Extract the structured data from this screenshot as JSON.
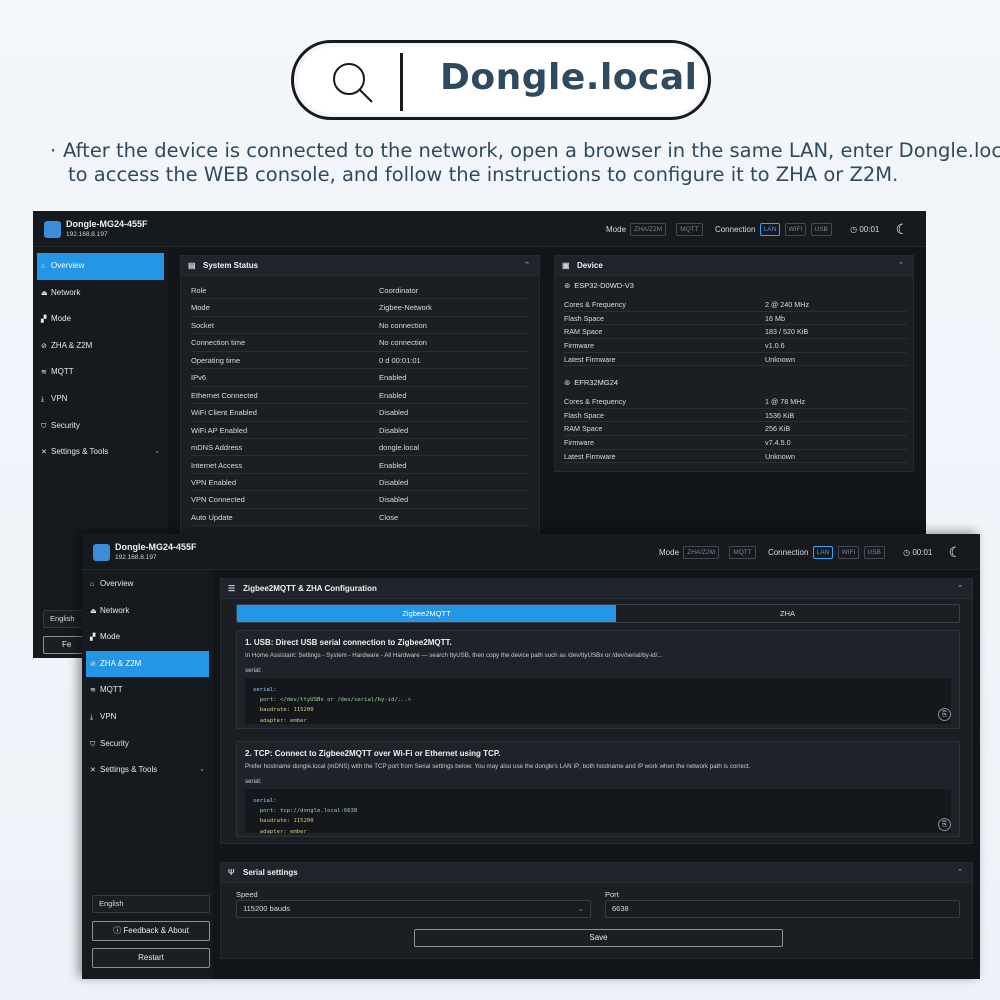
{
  "banner": {
    "url": "Dongle.local",
    "note_bullet": "·",
    "note_line1": "After the device is connected to the network, open a browser in the same LAN, enter Dongle.local",
    "note_line2": "to access the WEB console, and follow the instructions to configure it to ZHA or Z2M."
  },
  "header": {
    "device_name": "Dongle-MG24-455F",
    "ip": "192.168.8.197",
    "mode_label": "Mode",
    "mode_options": [
      "ZHA/Z2M",
      "MQTT"
    ],
    "connection_label": "Connection",
    "connection_options": [
      "LAN",
      "WIFI",
      "USB"
    ],
    "active_connection": "LAN",
    "uptime": "00:01"
  },
  "sidebar": {
    "items": [
      {
        "label": "Overview",
        "icon": "home-icon"
      },
      {
        "label": "Network",
        "icon": "network-icon"
      },
      {
        "label": "Mode",
        "icon": "chart-icon"
      },
      {
        "label": "ZHA & Z2M",
        "icon": "zigbee-icon"
      },
      {
        "label": "MQTT",
        "icon": "wifi-icon"
      },
      {
        "label": "VPN",
        "icon": "download-icon"
      },
      {
        "label": "Security",
        "icon": "shield-icon"
      },
      {
        "label": "Settings & Tools",
        "icon": "tools-icon"
      }
    ],
    "language": "English",
    "feedback_label": "Feedback & About",
    "feedback_partial": "Fe",
    "restart_label": "Restart"
  },
  "system_status": {
    "title": "System Status",
    "rows": [
      {
        "k": "Role",
        "v": "Coordinator"
      },
      {
        "k": "Mode",
        "v": "Zigbee-Network"
      },
      {
        "k": "Socket",
        "v": "No connection"
      },
      {
        "k": "Connection time",
        "v": "No connection"
      },
      {
        "k": "Operating time",
        "v": "0 d 00:01:01"
      },
      {
        "k": "IPv6",
        "v": "Enabled"
      },
      {
        "k": "Ethernet Connected",
        "v": "Enabled"
      },
      {
        "k": "WiFi Client Enabled",
        "v": "Disabled"
      },
      {
        "k": "WiFi AP Enabled",
        "v": "Disabled"
      },
      {
        "k": "mDNS Address",
        "v": "dongle.local"
      },
      {
        "k": "Internet Access",
        "v": "Enabled"
      },
      {
        "k": "VPN Enabled",
        "v": "Disabled"
      },
      {
        "k": "VPN Connected",
        "v": "Disabled"
      },
      {
        "k": "Auto Update",
        "v": "Close"
      }
    ]
  },
  "device": {
    "title": "Device",
    "esp_name": "ESP32-D0WD-V3",
    "esp_rows": [
      {
        "k": "Cores & Frequency",
        "v": "2 @ 240 MHz"
      },
      {
        "k": "Flash Space",
        "v": "16 Mb"
      },
      {
        "k": "RAM Space",
        "v": "183 / 520 KiB"
      },
      {
        "k": "Firmware",
        "v": "v1.0.6"
      },
      {
        "k": "Latest Firmware",
        "v": "Unknown"
      }
    ],
    "efr_name": "EFR32MG24",
    "efr_rows": [
      {
        "k": "Cores & Frequency",
        "v": "1 @ 78 MHz"
      },
      {
        "k": "Flash Space",
        "v": "1536 KiB"
      },
      {
        "k": "RAM Space",
        "v": "256 KiB"
      },
      {
        "k": "Firmware",
        "v": "v7.4.5.0"
      },
      {
        "k": "Latest Firmware",
        "v": "Unknown"
      }
    ]
  },
  "config": {
    "title": "Zigbee2MQTT & ZHA Configuration",
    "tabs": [
      "Zigbee2MQTT",
      "ZHA"
    ],
    "usb_title": "1. USB: Direct USB serial connection to Zigbee2MQTT.",
    "usb_desc": "In Home Assistant: Settings - System - Hardware - All Hardware — search ttyUSB, then copy the device path such as /dev/ttyUSBx or /dev/serial/by-id/...",
    "usb_label": "serial:",
    "usb_code": [
      "serial:",
      "  port: </dev/ttyUSBx or /dev/serial/by-id/...>",
      "  baudrate: 115200",
      "  adapter: ember"
    ],
    "tcp_title": "2. TCP: Connect to Zigbee2MQTT over Wi-Fi or Ethernet using TCP.",
    "tcp_desc": "Prefer hostname dongle.local (mDNS) with the TCP port from Serial settings below. You may also use the dongle's LAN IP; both hostname and IP work when the network path is correct.",
    "tcp_label": "serial:",
    "tcp_code": [
      "serial:",
      "  port: tcp://dongle.local:6638",
      "  baudrate: 115200",
      "  adapter: ember"
    ]
  },
  "serial": {
    "title": "Serial settings",
    "speed_label": "Speed",
    "speed_value": "115200 bauds",
    "port_label": "Port",
    "port_value": "6638",
    "save_label": "Save"
  },
  "colors": {
    "accent": "#2396e6",
    "background": "#111418",
    "panel": "#1b1f24"
  }
}
